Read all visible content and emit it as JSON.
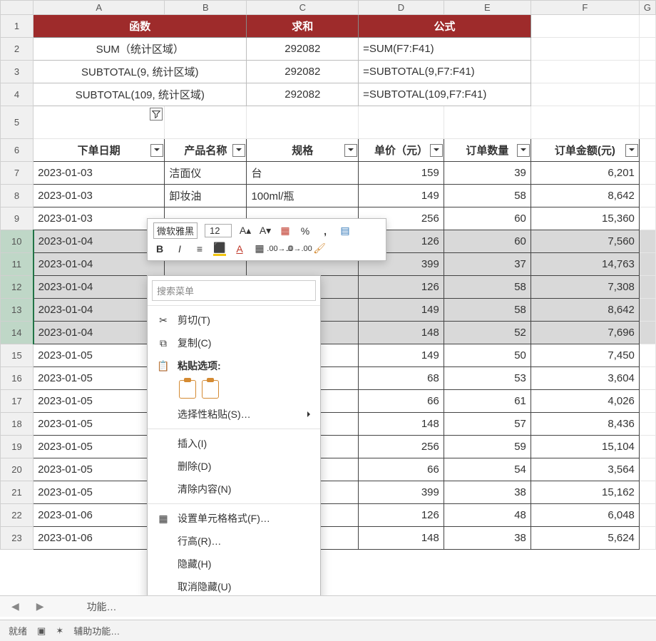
{
  "columns": [
    "A",
    "B",
    "C",
    "D",
    "E",
    "F",
    "G"
  ],
  "header": {
    "fn_label": "函数",
    "sum_label": "求和",
    "formula_label": "公式"
  },
  "fn_rows": [
    {
      "fn": "SUM（统计区域）",
      "sum": "292082",
      "formula": "=SUM(F7:F41)"
    },
    {
      "fn": "SUBTOTAL(9, 统计区域)",
      "sum": "292082",
      "formula": "=SUBTOTAL(9,F7:F41)"
    },
    {
      "fn": "SUBTOTAL(109, 统计区域)",
      "sum": "292082",
      "formula": "=SUBTOTAL(109,F7:F41)"
    }
  ],
  "table_headers": {
    "date": "下单日期",
    "product": "产品名称",
    "spec": "规格",
    "price": "单价（元）",
    "qty": "订单数量",
    "amount": "订单金额(元)"
  },
  "rows": [
    {
      "date": "2023-01-03",
      "product": "洁面仪",
      "spec": "台",
      "price": "159",
      "qty": "39",
      "amount": "6,201"
    },
    {
      "date": "2023-01-03",
      "product": "卸妆油",
      "spec": "100ml/瓶",
      "price": "149",
      "qty": "58",
      "amount": "8,642"
    },
    {
      "date": "2023-01-03",
      "product": "",
      "spec": "",
      "price": "256",
      "qty": "60",
      "amount": "15,360"
    },
    {
      "date": "2023-01-04",
      "product": "",
      "spec": "",
      "price": "126",
      "qty": "60",
      "amount": "7,560"
    },
    {
      "date": "2023-01-04",
      "product": "",
      "spec": "",
      "price": "399",
      "qty": "37",
      "amount": "14,763"
    },
    {
      "date": "2023-01-04",
      "product": "",
      "spec": "",
      "price": "126",
      "qty": "58",
      "amount": "7,308"
    },
    {
      "date": "2023-01-04",
      "product": "",
      "spec": "",
      "price": "149",
      "qty": "58",
      "amount": "8,642"
    },
    {
      "date": "2023-01-04",
      "product": "",
      "spec": "",
      "price": "148",
      "qty": "52",
      "amount": "7,696"
    },
    {
      "date": "2023-01-05",
      "product": "",
      "spec": "",
      "price": "149",
      "qty": "50",
      "amount": "7,450"
    },
    {
      "date": "2023-01-05",
      "product": "",
      "spec": "",
      "price": "68",
      "qty": "53",
      "amount": "3,604"
    },
    {
      "date": "2023-01-05",
      "product": "",
      "spec": "",
      "price": "66",
      "qty": "61",
      "amount": "4,026"
    },
    {
      "date": "2023-01-05",
      "product": "",
      "spec": "",
      "price": "148",
      "qty": "57",
      "amount": "8,436"
    },
    {
      "date": "2023-01-05",
      "product": "",
      "spec": "",
      "price": "256",
      "qty": "59",
      "amount": "15,104"
    },
    {
      "date": "2023-01-05",
      "product": "",
      "spec": "",
      "price": "66",
      "qty": "54",
      "amount": "3,564"
    },
    {
      "date": "2023-01-05",
      "product": "",
      "spec": "",
      "price": "399",
      "qty": "38",
      "amount": "15,162"
    },
    {
      "date": "2023-01-06",
      "product": "",
      "spec": "",
      "price": "126",
      "qty": "48",
      "amount": "6,048"
    },
    {
      "date": "2023-01-06",
      "product": "",
      "spec": "",
      "price": "148",
      "qty": "38",
      "amount": "5,624"
    }
  ],
  "minibar": {
    "font": "微软雅黑",
    "size": "12"
  },
  "cmenu": {
    "search_ph": "搜索菜单",
    "cut": "剪切(T)",
    "copy": "复制(C)",
    "paste_opts": "粘贴选项:",
    "paste_special": "选择性粘贴(S)…",
    "insert": "插入(I)",
    "delete": "删除(D)",
    "clear": "清除内容(N)",
    "format_cells": "设置单元格格式(F)…",
    "row_height": "行高(R)…",
    "hide": "隐藏(H)",
    "unhide": "取消隐藏(U)"
  },
  "tabbar": {
    "tab1": "功能…"
  },
  "status": {
    "ready": "就绪",
    "access": "辅助功能…"
  }
}
